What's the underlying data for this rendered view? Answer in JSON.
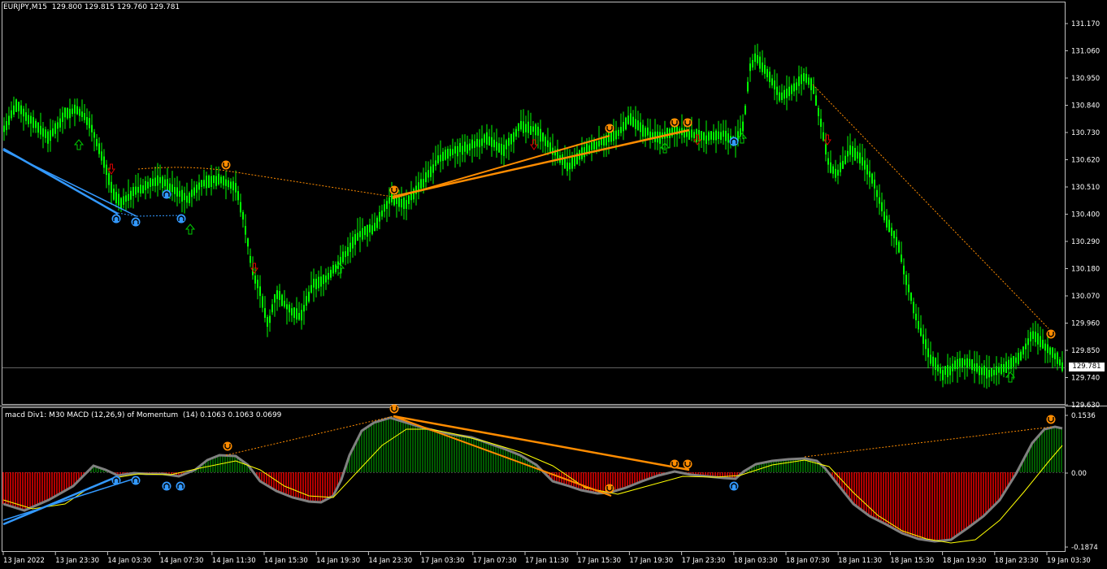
{
  "main_title": "EURJPY,M15  129.800 129.815 129.760 129.781",
  "indicator_title": "macd Div1: M30 MACD (12,26,9) of Momentum  (14) 0.1063 0.1063 0.0699",
  "current_price": "129.781",
  "price_axis": [
    "131.170",
    "131.060",
    "130.950",
    "130.840",
    "130.730",
    "130.620",
    "130.510",
    "130.400",
    "130.290",
    "130.180",
    "130.070",
    "129.960",
    "129.850",
    "129.740",
    "129.630"
  ],
  "indicator_axis": [
    "0.1536",
    "0.00",
    "-0.1874"
  ],
  "time_axis": [
    "13 Jan 2022",
    "13 Jan 23:30",
    "14 Jan 03:30",
    "14 Jan 07:30",
    "14 Jan 11:30",
    "14 Jan 15:30",
    "14 Jan 19:30",
    "14 Jan 23:30",
    "17 Jan 03:30",
    "17 Jan 07:30",
    "17 Jan 11:30",
    "17 Jan 15:30",
    "17 Jan 19:30",
    "17 Jan 23:30",
    "18 Jan 03:30",
    "18 Jan 07:30",
    "18 Jan 11:30",
    "18 Jan 15:30",
    "18 Jan 19:30",
    "18 Jan 23:30",
    "19 Jan 03:30"
  ],
  "colors": {
    "background": "#000000",
    "candle": "#00ff00",
    "hist_pos": "#008000",
    "hist_neg": "#ff0000",
    "macd_line": "#808080",
    "signal_line": "#ffff00",
    "bull_div": "#3399ff",
    "bear_div": "#ff8c00"
  },
  "icons": {
    "bull_marker": "blue-circle-up-icon",
    "bear_marker": "orange-circle-down-icon",
    "buy_arrow": "green-up-arrow-icon",
    "sell_arrow": "red-down-arrow-icon"
  }
}
